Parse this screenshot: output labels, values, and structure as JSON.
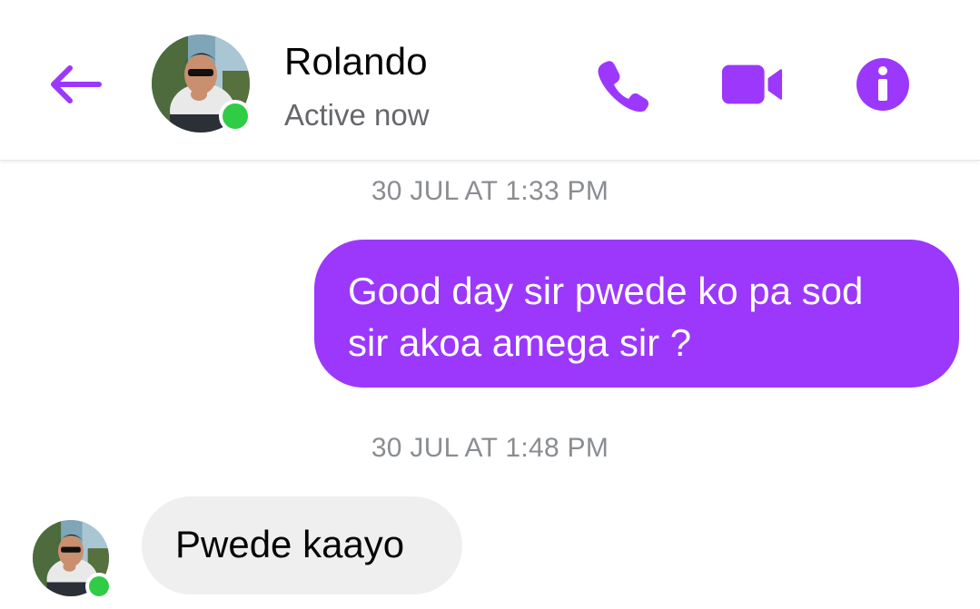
{
  "colors": {
    "accent": "#9b38fc",
    "online": "#31cc46",
    "incoming_bubble": "#efefef",
    "timestamp": "#8a8d91",
    "status_text": "#65676b"
  },
  "header": {
    "contact_name": "Rolando",
    "status": "Active now",
    "icons": {
      "back": "arrow-left-icon",
      "call": "phone-icon",
      "video": "video-camera-icon",
      "info": "info-icon"
    }
  },
  "messages": [
    {
      "timestamp": "30 JUL AT 1:33 PM",
      "direction": "outgoing",
      "lines": [
        "Good day sir pwede ko pa sod",
        "sir akoa amega sir ?"
      ]
    },
    {
      "timestamp": "30 JUL AT 1:48 PM",
      "direction": "incoming",
      "lines": [
        "Pwede kaayo"
      ]
    }
  ]
}
